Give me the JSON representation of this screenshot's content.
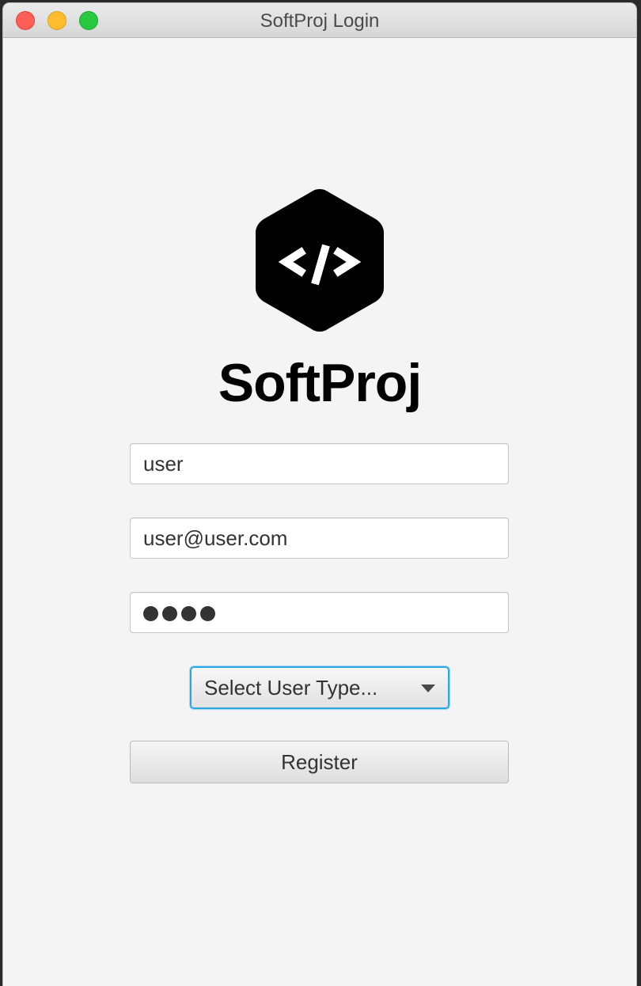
{
  "window": {
    "title": "SoftProj Login"
  },
  "brand": {
    "name": "SoftProj",
    "logo_icon": "code-hexagon-icon",
    "logo_color": "#000000"
  },
  "form": {
    "username_value": "user",
    "email_value": "user@user.com",
    "password_masked_length": 4,
    "user_type_label": "Select User Type...",
    "register_label": "Register"
  },
  "colors": {
    "focus_accent": "#2aa6e0",
    "close": "#fd5f57",
    "minimize": "#febc2e",
    "zoom": "#28c840"
  }
}
